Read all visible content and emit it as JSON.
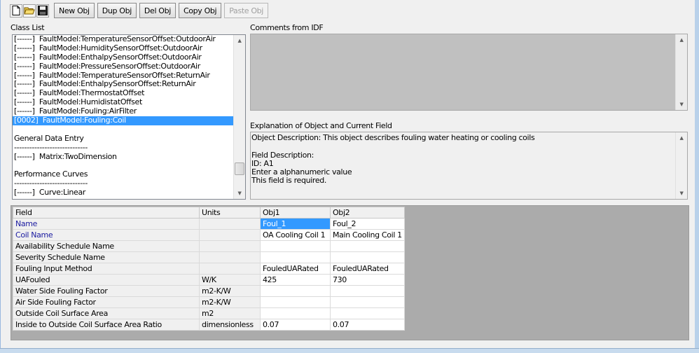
{
  "toolbar": {
    "new_obj": "New Obj",
    "dup_obj": "Dup Obj",
    "del_obj": "Del Obj",
    "copy_obj": "Copy Obj",
    "paste_obj": "Paste Obj"
  },
  "class_list": {
    "label": "Class List",
    "rows": [
      "[------]  FaultModel:TemperatureSensorOffset:OutdoorAir",
      "[------]  FaultModel:HumiditySensorOffset:OutdoorAir",
      "[------]  FaultModel:EnthalpySensorOffset:OutdoorAir",
      "[------]  FaultModel:PressureSensorOffset:OutdoorAir",
      "[------]  FaultModel:TemperatureSensorOffset:ReturnAir",
      "[------]  FaultModel:EnthalpySensorOffset:ReturnAir",
      "[------]  FaultModel:ThermostatOffset",
      "[------]  FaultModel:HumidistatOffset",
      "[------]  FaultModel:Fouling:AirFilter",
      "[0002]  FaultModel:Fouling:Coil",
      "",
      "General Data Entry",
      "-----------------------------",
      "[------]  Matrix:TwoDimension",
      "",
      "Performance Curves",
      "-----------------------------",
      "[------]  Curve:Linear"
    ],
    "selected_index": 9
  },
  "comments": {
    "label": "Comments from IDF",
    "text": ""
  },
  "explanation": {
    "label": "Explanation of Object and Current Field",
    "lines": [
      "Object Description: This object describes fouling water heating or cooling coils",
      "",
      "Field Description:",
      "ID: A1",
      "Enter a alphanumeric value",
      "This field is required."
    ]
  },
  "grid": {
    "headers": {
      "field": "Field",
      "units": "Units",
      "obj1": "Obj1",
      "obj2": "Obj2"
    },
    "rows": [
      {
        "field": "Name",
        "units": "",
        "obj1": "Foul_1",
        "obj2": "Foul_2",
        "required": true
      },
      {
        "field": "Coil Name",
        "units": "",
        "obj1": "OA Cooling Coil 1",
        "obj2": "Main Cooling Coil 1",
        "required": true
      },
      {
        "field": "Availability Schedule Name",
        "units": "",
        "obj1": "",
        "obj2": ""
      },
      {
        "field": "Severity Schedule Name",
        "units": "",
        "obj1": "",
        "obj2": ""
      },
      {
        "field": "Fouling Input Method",
        "units": "",
        "obj1": "FouledUARated",
        "obj2": "FouledUARated"
      },
      {
        "field": "UAFouled",
        "units": "W/K",
        "obj1": "425",
        "obj2": "730"
      },
      {
        "field": "Water Side Fouling Factor",
        "units": "m2-K/W",
        "obj1": "",
        "obj2": ""
      },
      {
        "field": "Air Side Fouling Factor",
        "units": "m2-K/W",
        "obj1": "",
        "obj2": ""
      },
      {
        "field": "Outside Coil Surface Area",
        "units": "m2",
        "obj1": "",
        "obj2": ""
      },
      {
        "field": "Inside to Outside Coil Surface Area Ratio",
        "units": "dimensionless",
        "obj1": "0.07",
        "obj2": "0.07"
      }
    ]
  },
  "icons": {
    "new": "new-file-icon",
    "open": "open-folder-icon",
    "save": "save-disk-icon"
  }
}
